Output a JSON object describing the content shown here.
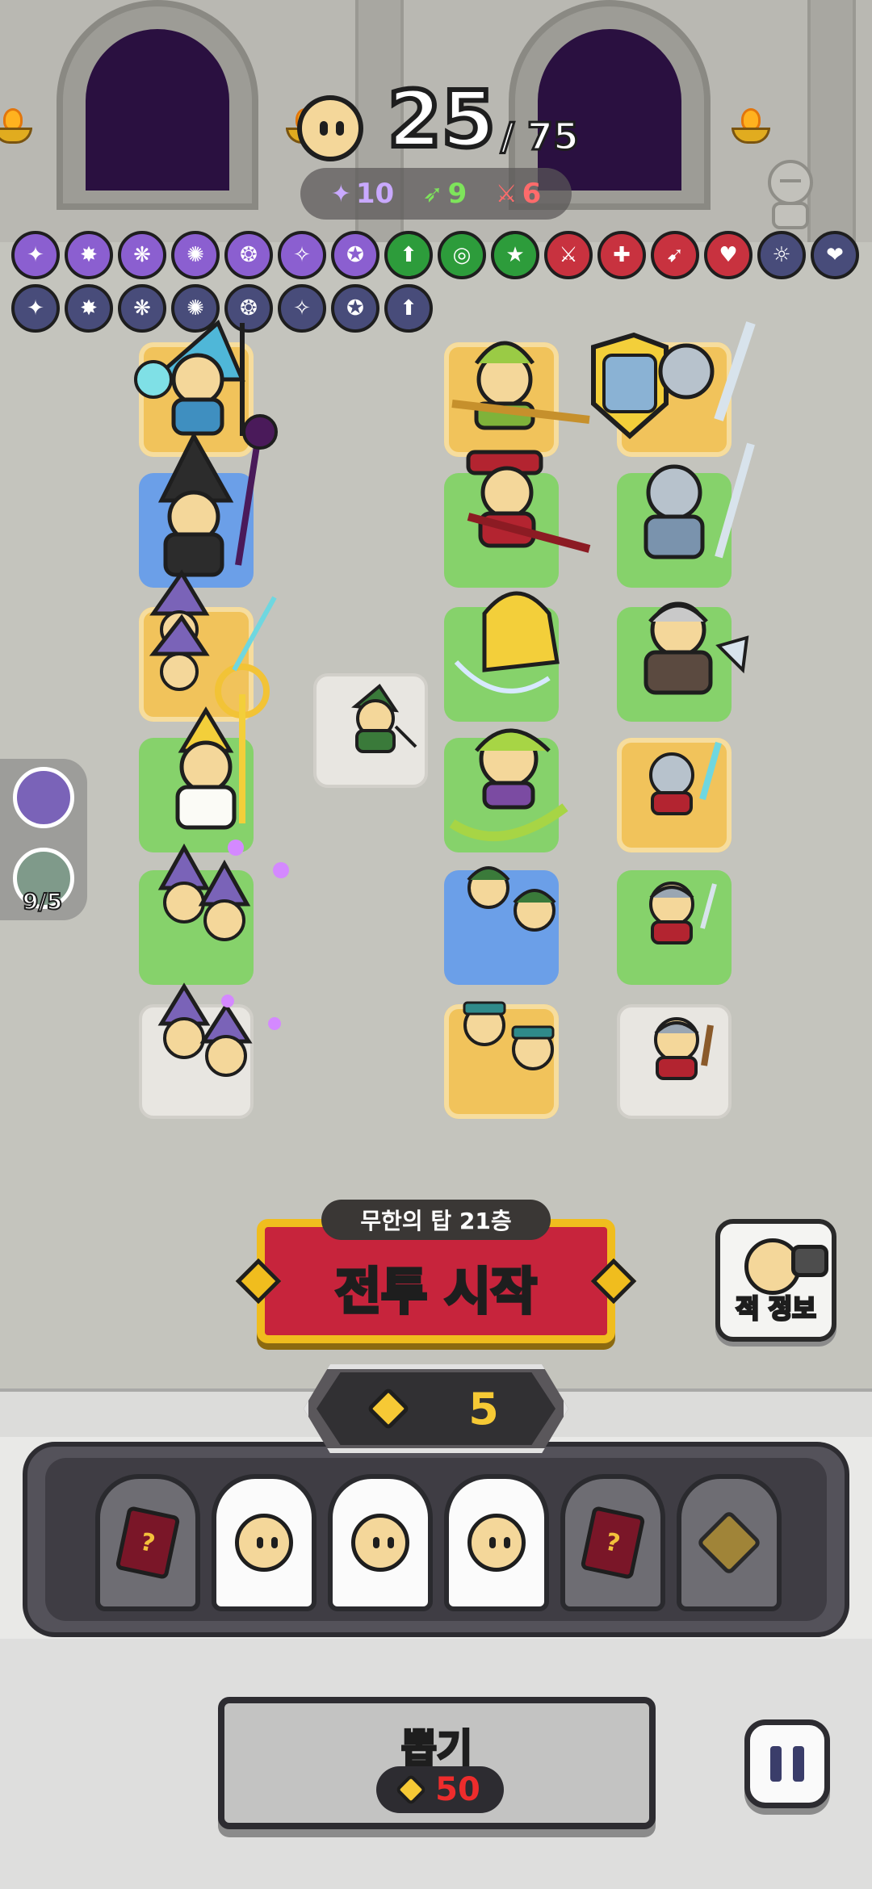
{
  "hud": {
    "unit_count": "25",
    "unit_max": "/ 75",
    "stats": {
      "magic": "10",
      "ranged": "9",
      "melee": "6"
    }
  },
  "buffs": {
    "row1": [
      {
        "name": "magic-missile-icon",
        "color": "#8b5fd0"
      },
      {
        "name": "fire-orb-icon",
        "color": "#8b5fd0"
      },
      {
        "name": "tornado-icon",
        "color": "#8b5fd0"
      },
      {
        "name": "spider-swarm-icon",
        "color": "#8b5fd0"
      },
      {
        "name": "ice-tornado-icon",
        "color": "#8b5fd0"
      },
      {
        "name": "potion-icon",
        "color": "#8b5fd0"
      },
      {
        "name": "purple-gem-icon",
        "color": "#8b5fd0"
      },
      {
        "name": "arrow-up-icon",
        "color": "#2d9c3b"
      },
      {
        "name": "target-icon",
        "color": "#2d9c3b"
      },
      {
        "name": "crit-icon",
        "color": "#2d9c3b"
      },
      {
        "name": "sword-knight-icon",
        "color": "#c8323f"
      },
      {
        "name": "warrior-icon",
        "color": "#c8323f"
      },
      {
        "name": "sword-slash-icon",
        "color": "#c8323f"
      },
      {
        "name": "heal-icon",
        "color": "#c8323f"
      },
      {
        "name": "priest-icon",
        "color": "#484c7a"
      },
      {
        "name": "heart-up-icon",
        "color": "#484c7a"
      }
    ],
    "row2": [
      {
        "name": "crowd-icon",
        "color": "#484c7a"
      },
      {
        "name": "army-icon",
        "color": "#484c7a"
      },
      {
        "name": "burst-icon",
        "color": "#484c7a"
      },
      {
        "name": "crystal-icon",
        "color": "#484c7a"
      },
      {
        "name": "goblin-target-icon",
        "color": "#484c7a"
      },
      {
        "name": "potion-altar-icon",
        "color": "#484c7a"
      },
      {
        "name": "money-icon",
        "color": "#484c7a"
      },
      {
        "name": "treasure-chest-icon",
        "color": "#484c7a"
      }
    ]
  },
  "side": {
    "counter": "9/5"
  },
  "battle": {
    "floor_tag": "무한의 탑 21층",
    "start_label": "전투 시작"
  },
  "enemy_info": {
    "label": "적 정보"
  },
  "gold": {
    "amount": "5"
  },
  "draw": {
    "label": "뽑기",
    "cost": "50"
  }
}
